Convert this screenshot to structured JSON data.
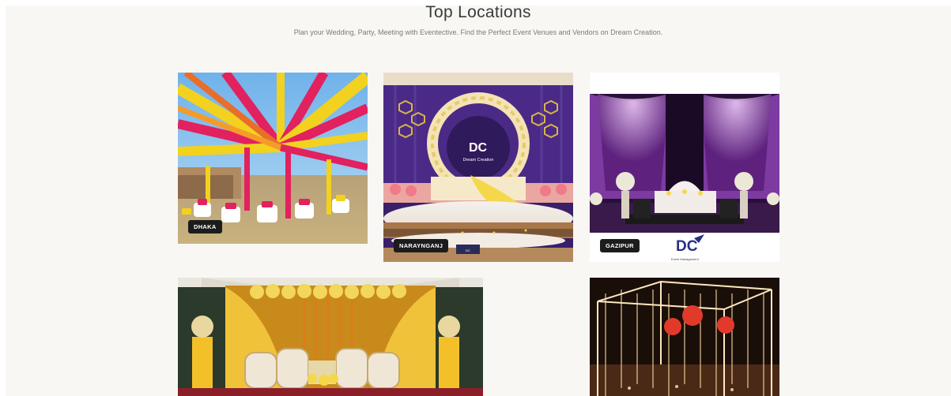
{
  "header": {
    "title": "Top Locations",
    "subtitle": "Plan your Wedding, Party, Meeting with Eventective. Find the Perfect Event Venues and Vendors on Dream Creation."
  },
  "locations": [
    {
      "label": "DHAKA"
    },
    {
      "label": "NARAYNGANJ"
    },
    {
      "label": "GAZIPUR"
    }
  ],
  "logos": {
    "narayanganj_caption": "Dream Creation",
    "gazipur_caption": "Event Management"
  },
  "colors": {
    "section_bg": "#f8f7f4",
    "badge_bg": "#1c1c1c",
    "title": "#3b3b3b"
  }
}
